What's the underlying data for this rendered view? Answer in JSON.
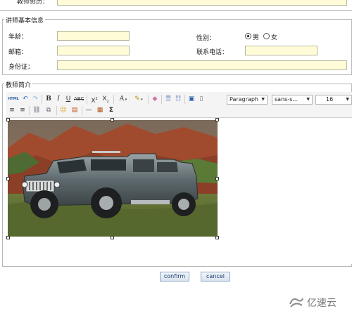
{
  "top_row": {
    "label": "教师资历：",
    "value": ""
  },
  "basic_info": {
    "legend": "讲师基本信息",
    "age_label": "年龄：",
    "age_value": "",
    "gender_label": "性别：",
    "gender_options": [
      "男",
      "女"
    ],
    "gender_selected": "男",
    "email_label": "邮箱：",
    "email_value": "",
    "phone_label": "联系电话：",
    "phone_value": "",
    "idcard_label": "身份证：",
    "idcard_value": ""
  },
  "intro": {
    "legend": "教师简介",
    "toolbar": {
      "html_label": "HTML",
      "format_select": "Paragraph",
      "font_select": "sans-s...",
      "size_select": "16",
      "icons": [
        "source-icon",
        "undo-icon",
        "redo-icon",
        "bold-icon",
        "italic-icon",
        "underline-icon",
        "strikethrough-icon",
        "superscript-icon",
        "subscript-icon",
        "font-color-icon",
        "highlight-icon",
        "eraser-icon",
        "ordered-list-icon",
        "unordered-list-icon",
        "paste-word-icon",
        "paste-text-icon",
        "align-left-icon",
        "align-right-icon",
        "link-icon",
        "unlink-icon",
        "emoticon-icon",
        "image-icon",
        "hr-icon",
        "template-icon",
        "formula-icon"
      ]
    },
    "image_alt": "Silver Hummer H2 SUT on grass with red rock mountains behind"
  },
  "actions": {
    "confirm": "confirm",
    "cancel": "cancel"
  },
  "watermark": "亿速云",
  "colors": {
    "field_bg": "#fffcd7",
    "button_text": "#1a3a66",
    "border": "#b7b7b7"
  }
}
